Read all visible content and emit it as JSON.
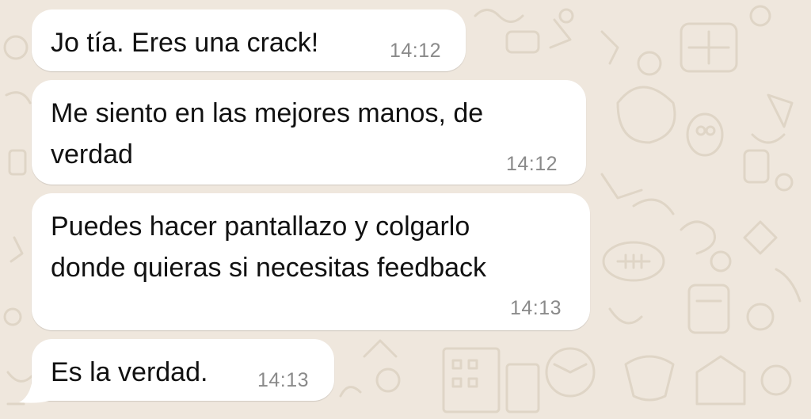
{
  "messages": [
    {
      "text": "Jo tía. Eres una crack!",
      "time": "14:12"
    },
    {
      "text": "Me siento en las mejores manos, de\nverdad",
      "time": "14:12"
    },
    {
      "text": "Puedes hacer pantallazo y colgarlo\ndonde quieras si necesitas feedback",
      "time": "14:13"
    },
    {
      "text": "Es la verdad.",
      "time": "14:13"
    }
  ],
  "colors": {
    "background": "#efe7dd",
    "bubble": "#ffffff",
    "text": "#111111",
    "timestamp": "#8a8a8a"
  }
}
